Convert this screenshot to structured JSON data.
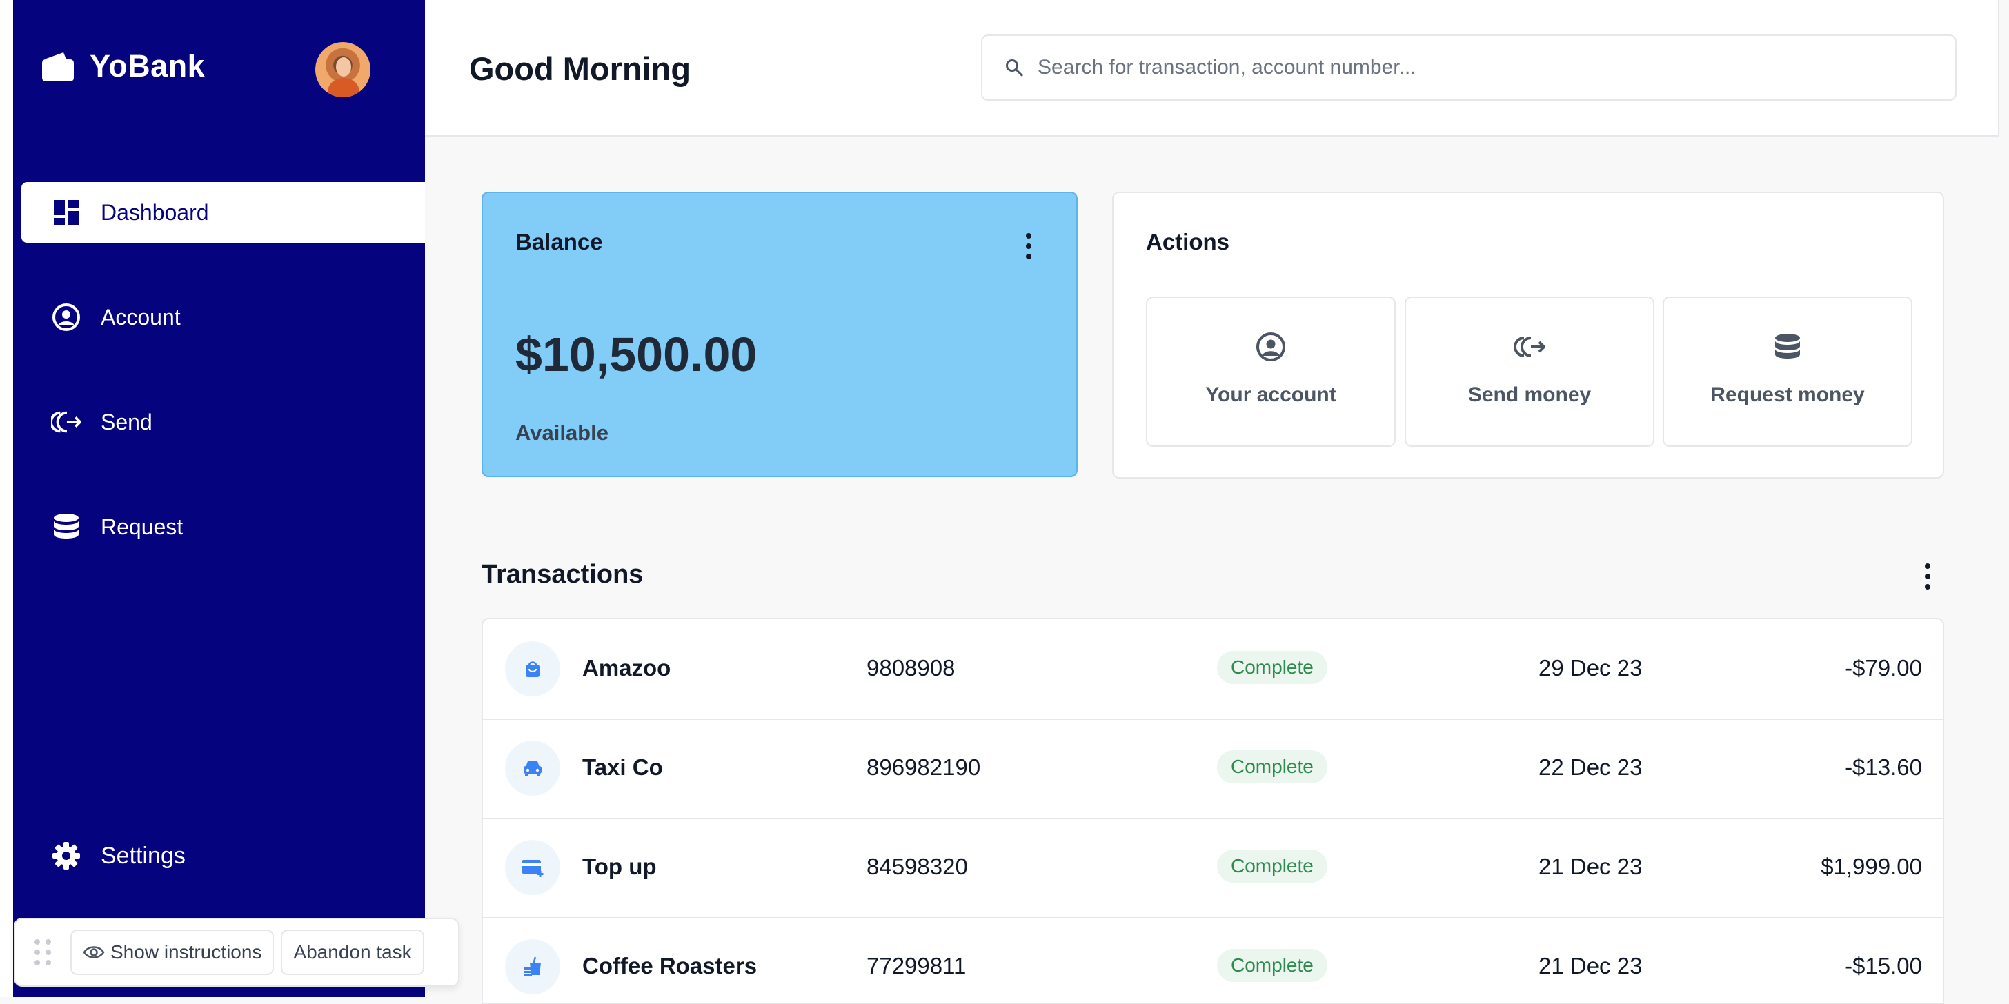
{
  "brand": {
    "name": "YoBank"
  },
  "sidebar": {
    "items": [
      {
        "label": "Dashboard",
        "icon": "dashboard-icon",
        "active": true
      },
      {
        "label": "Account",
        "icon": "user-circle-icon",
        "active": false
      },
      {
        "label": "Send",
        "icon": "send-icon",
        "active": false
      },
      {
        "label": "Request",
        "icon": "coins-stack-icon",
        "active": false
      }
    ],
    "settings_label": "Settings"
  },
  "taskbar": {
    "show_instructions": "Show instructions",
    "abandon_task": "Abandon task"
  },
  "header": {
    "greeting": "Good Morning",
    "search_placeholder": "Search for transaction, account number..."
  },
  "balance": {
    "title": "Balance",
    "amount": "$10,500.00",
    "subtitle": "Available"
  },
  "actions": {
    "title": "Actions",
    "items": [
      {
        "label": "Your account",
        "icon": "user-circle-icon"
      },
      {
        "label": "Send money",
        "icon": "send-icon"
      },
      {
        "label": "Request money",
        "icon": "coins-stack-icon"
      }
    ]
  },
  "transactions": {
    "title": "Transactions",
    "rows": [
      {
        "name": "Amazoo",
        "account": "9808908",
        "status": "Complete",
        "date": "29 Dec 23",
        "amount": "-$79.00",
        "icon": "shopping-bag-icon"
      },
      {
        "name": "Taxi Co",
        "account": "896982190",
        "status": "Complete",
        "date": "22 Dec 23",
        "amount": "-$13.60",
        "icon": "taxi-icon"
      },
      {
        "name": "Top up",
        "account": "84598320",
        "status": "Complete",
        "date": "21 Dec 23",
        "amount": "$1,999.00",
        "icon": "card-plus-icon"
      },
      {
        "name": "Coffee Roasters",
        "account": "77299811",
        "status": "Complete",
        "date": "21 Dec 23",
        "amount": "-$15.00",
        "icon": "coffee-icon"
      }
    ]
  },
  "colors": {
    "sidebar_bg": "#05037e",
    "balance_card_bg": "#81cdf8",
    "status_green": "#2f8a4f",
    "status_bg": "#eaf6ee"
  }
}
